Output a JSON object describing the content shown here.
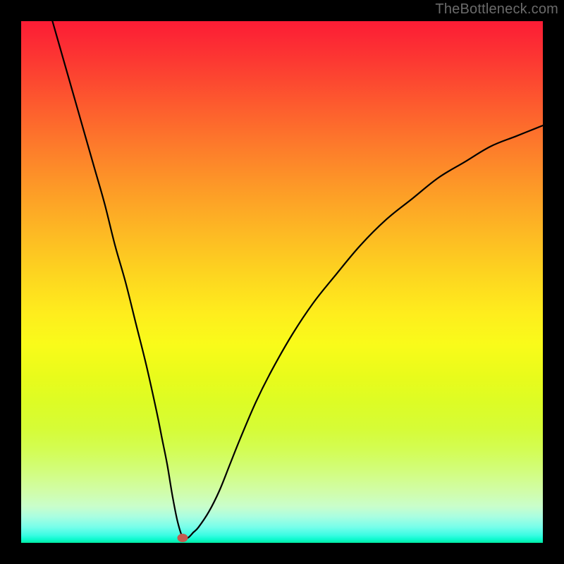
{
  "watermark": "TheBottleneck.com",
  "colors": {
    "curve_stroke": "#000000",
    "min_marker": "#c45b51",
    "frame": "#000000"
  },
  "chart_data": {
    "type": "line",
    "title": "",
    "xlabel": "",
    "ylabel": "",
    "xlim": [
      0,
      100
    ],
    "ylim": [
      0,
      100
    ],
    "min_point": {
      "x": 31,
      "y": 1
    },
    "series": [
      {
        "name": "bottleneck-curve",
        "x": [
          6,
          8,
          10,
          12,
          14,
          16,
          18,
          20,
          22,
          24,
          26,
          27,
          28,
          29,
          30,
          31,
          32,
          33,
          34,
          36,
          38,
          40,
          42,
          45,
          48,
          52,
          56,
          60,
          65,
          70,
          75,
          80,
          85,
          90,
          95,
          100
        ],
        "values": [
          100,
          93,
          86,
          79,
          72,
          65,
          57,
          50,
          42,
          34,
          25,
          20,
          15,
          9,
          4,
          1,
          1,
          2,
          3,
          6,
          10,
          15,
          20,
          27,
          33,
          40,
          46,
          51,
          57,
          62,
          66,
          70,
          73,
          76,
          78,
          80
        ]
      }
    ]
  }
}
